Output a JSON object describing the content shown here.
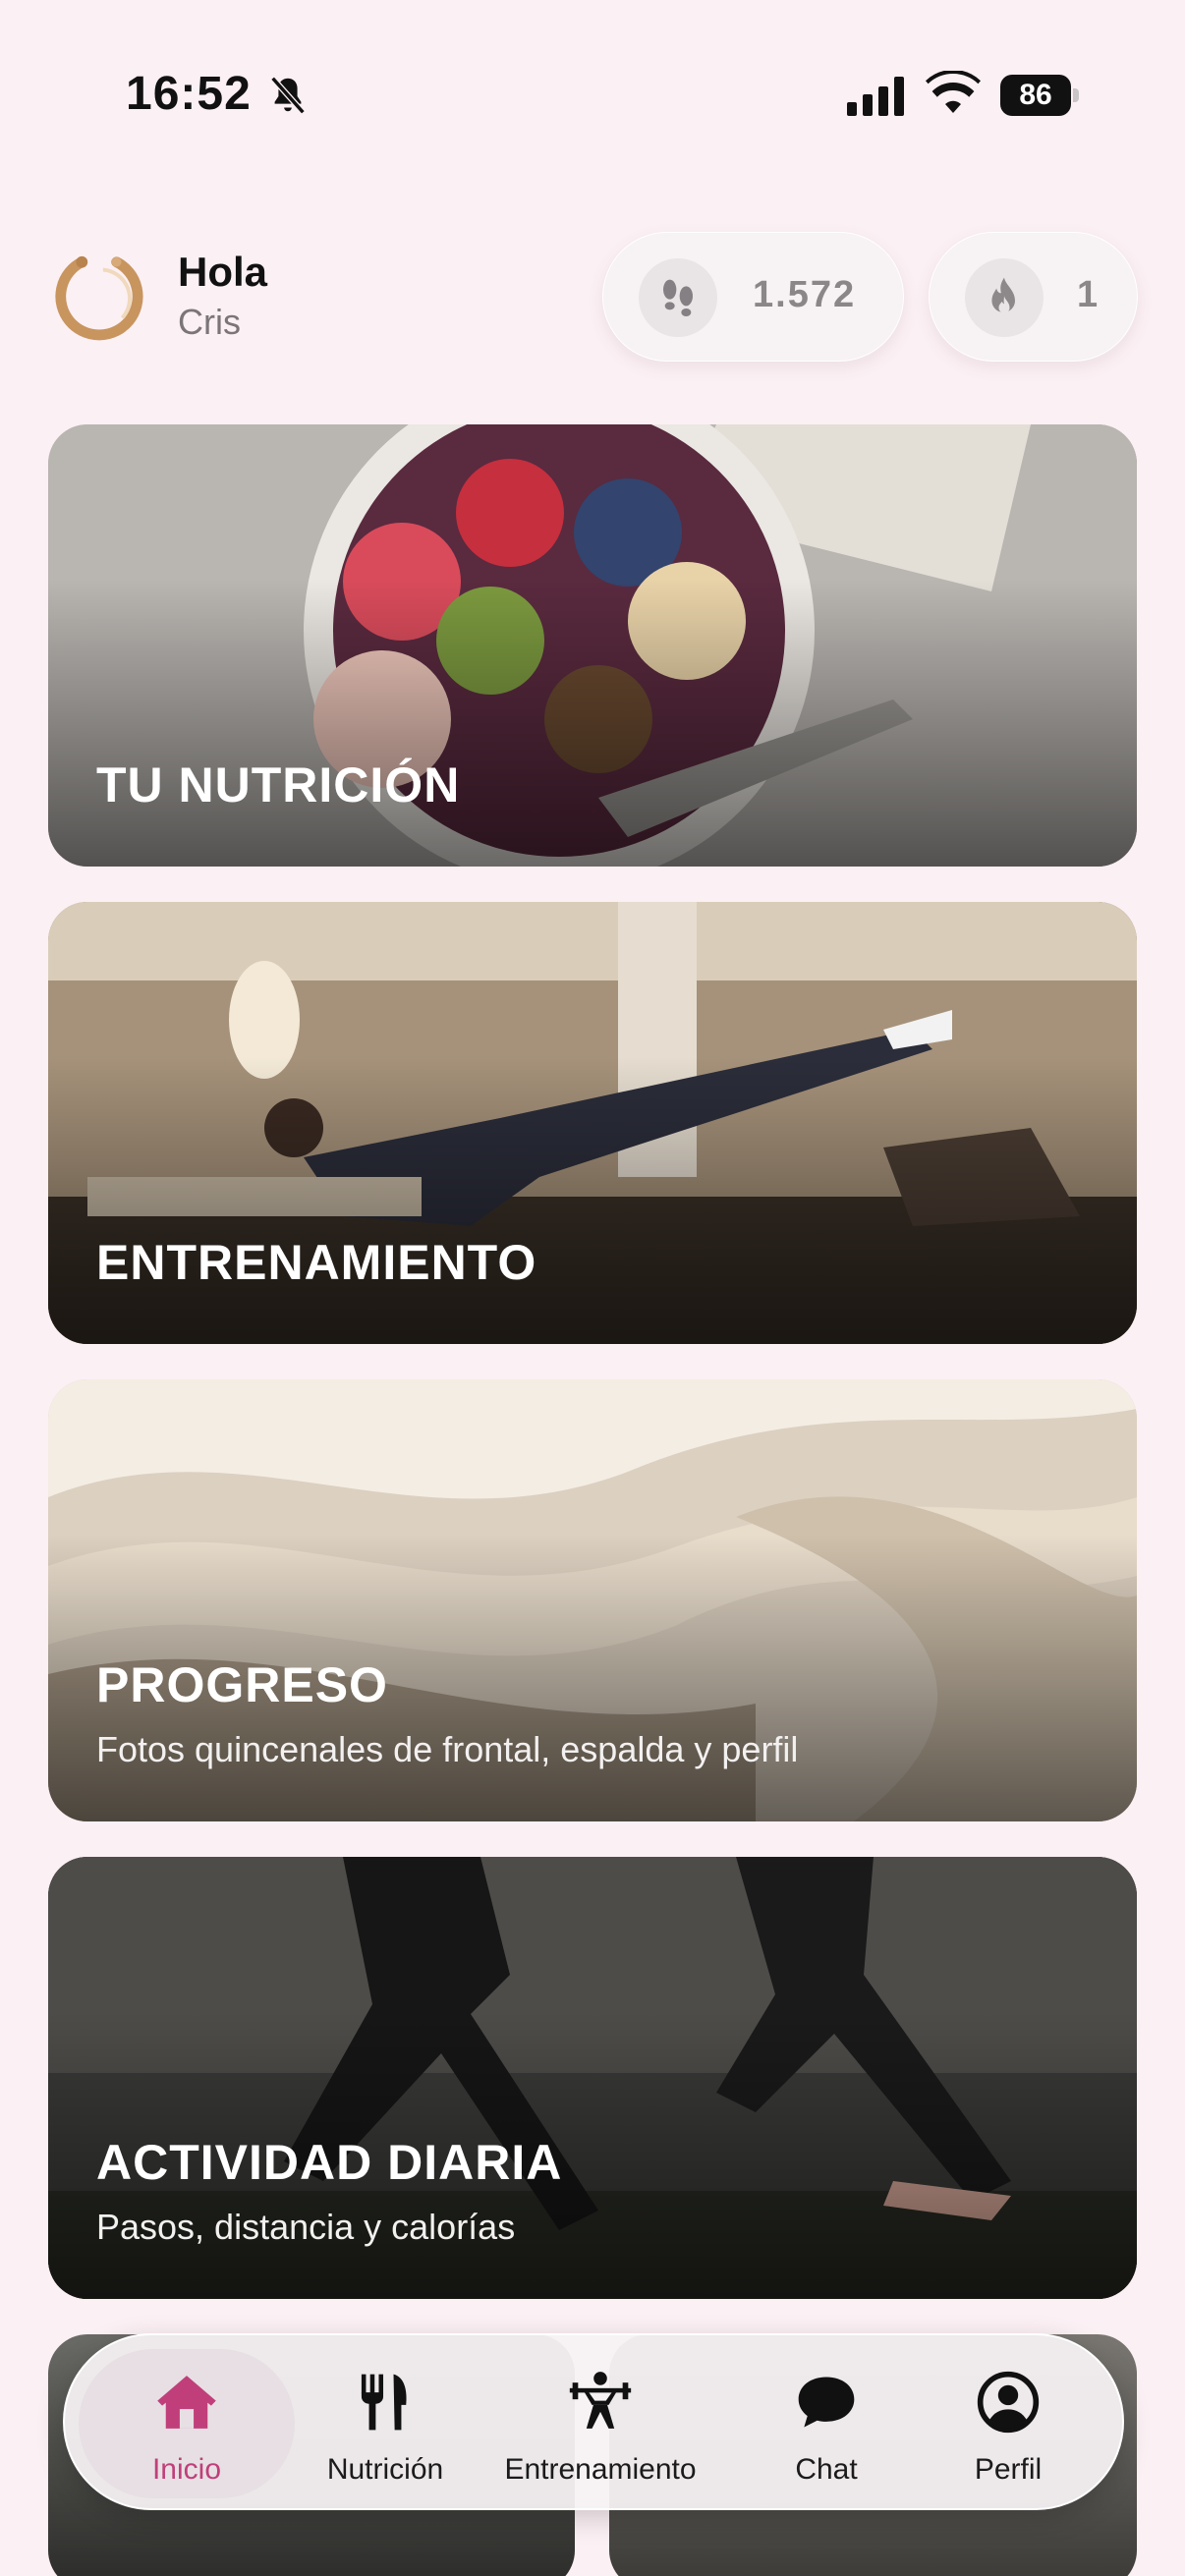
{
  "status_bar": {
    "time": "16:52",
    "battery": "86"
  },
  "header": {
    "greeting": "Hola",
    "user_name": "Cris",
    "steps_value": "1.572",
    "streak_value": "1"
  },
  "cards": [
    {
      "title": "TU NUTRICIÓN",
      "subtitle": ""
    },
    {
      "title": "ENTRENAMIENTO",
      "subtitle": ""
    },
    {
      "title": "PROGRESO",
      "subtitle": "Fotos quincenales de frontal, espalda y perfil"
    },
    {
      "title": "ACTIVIDAD DIARIA",
      "subtitle": "Pasos, distancia y calorías"
    }
  ],
  "tab_bar": {
    "active": "Inicio",
    "items": [
      {
        "label": "Inicio",
        "icon": "home-icon"
      },
      {
        "label": "Nutrición",
        "icon": "fork-knife-icon"
      },
      {
        "label": "Entrenamiento",
        "icon": "weightlifter-icon"
      },
      {
        "label": "Chat",
        "icon": "chat-bubble-icon"
      },
      {
        "label": "Perfil",
        "icon": "profile-icon"
      }
    ]
  },
  "colors": {
    "background": "#fbf0f4",
    "accent": "#c03f7a",
    "logo_gold": "#c8955f"
  }
}
